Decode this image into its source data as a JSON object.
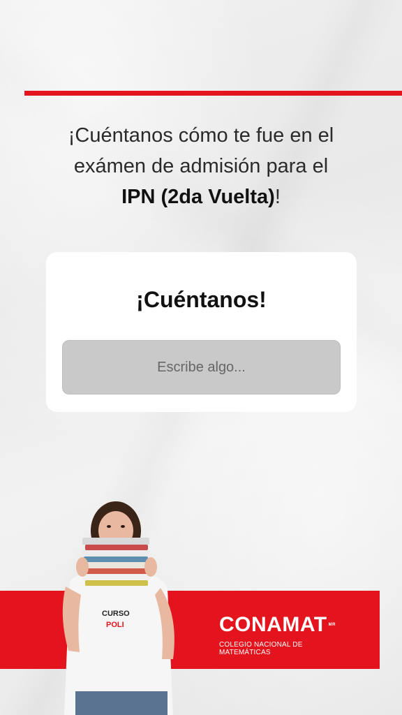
{
  "headline": {
    "line1": "¡Cuéntanos cómo te fue en el",
    "line2": "exámen de admisión para el",
    "bold": "IPN (2da Vuelta)",
    "suffix": "!"
  },
  "card": {
    "title": "¡Cuéntanos!",
    "input_placeholder": "Escribe algo..."
  },
  "brand": {
    "name": "CONAMAT",
    "mark": "MR",
    "tagline": "COLEGIO NACIONAL DE MATEMÁTICAS",
    "shirt_line1": "CURSO",
    "shirt_line2": "POLI"
  },
  "colors": {
    "accent": "#e3141d",
    "card": "#ffffff",
    "input": "#c9c9c9"
  }
}
